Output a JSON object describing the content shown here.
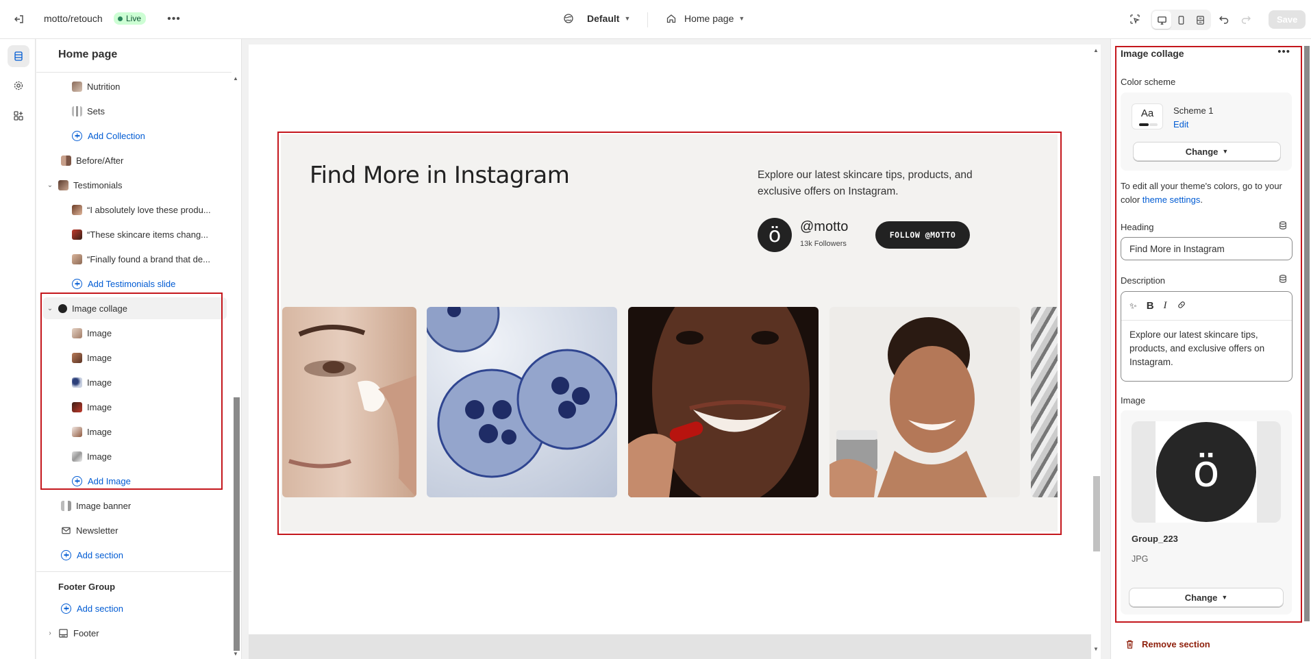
{
  "topbar": {
    "store_name": "motto/retouch",
    "status": "Live",
    "theme_dropdown": "Default",
    "page_dropdown": "Home page",
    "save_label": "Save"
  },
  "sidebar": {
    "title": "Home page",
    "items": [
      {
        "label": "Nutrition",
        "level": 2,
        "type": "block"
      },
      {
        "label": "Sets",
        "level": 2,
        "type": "block"
      },
      {
        "label": "Add Collection",
        "level": 2,
        "type": "add"
      },
      {
        "label": "Before/After",
        "level": 1,
        "type": "section"
      },
      {
        "label": "Testimonials",
        "level": 1,
        "type": "section",
        "expanded": true
      },
      {
        "label": "“I absolutely love these produ...",
        "level": 2,
        "type": "block"
      },
      {
        "label": "“These skincare items chang...",
        "level": 2,
        "type": "block"
      },
      {
        "label": "“Finally found a brand that de...",
        "level": 2,
        "type": "block"
      },
      {
        "label": "Add Testimonials slide",
        "level": 2,
        "type": "add"
      },
      {
        "label": "Image collage",
        "level": 1,
        "type": "section",
        "expanded": true,
        "selected": true
      },
      {
        "label": "Image",
        "level": 2,
        "type": "block"
      },
      {
        "label": "Image",
        "level": 2,
        "type": "block"
      },
      {
        "label": "Image",
        "level": 2,
        "type": "block"
      },
      {
        "label": "Image",
        "level": 2,
        "type": "block"
      },
      {
        "label": "Image",
        "level": 2,
        "type": "block"
      },
      {
        "label": "Image",
        "level": 2,
        "type": "block"
      },
      {
        "label": "Add Image",
        "level": 2,
        "type": "add"
      },
      {
        "label": "Image banner",
        "level": 1,
        "type": "section"
      },
      {
        "label": "Newsletter",
        "level": 1,
        "type": "section"
      },
      {
        "label": "Add section",
        "level": 1,
        "type": "add"
      }
    ],
    "footer_group": {
      "title": "Footer Group",
      "add_label": "Add section",
      "footer_label": "Footer"
    }
  },
  "preview": {
    "heading": "Find More in Instagram",
    "description": "Explore our latest skincare tips, products, and exclusive offers on Instagram.",
    "avatar_letter": "ö",
    "handle": "@motto",
    "followers": "13k Followers",
    "follow_button": "FOLLOW @MOTTO"
  },
  "panel": {
    "title": "Image collage",
    "color_scheme_label": "Color scheme",
    "scheme_swatch": "Aa",
    "scheme_name": "Scheme 1",
    "scheme_edit": "Edit",
    "change_label": "Change",
    "help_text_pre": "To edit all your theme's colors, go to your color ",
    "help_link": "theme settings",
    "help_text_post": ".",
    "heading_label": "Heading",
    "heading_value": "Find More in Instagram",
    "description_label": "Description",
    "description_value": "Explore our latest skincare tips, products, and exclusive offers on Instagram.",
    "image_label": "Image",
    "image_letter": "ö",
    "image_name": "Group_223",
    "image_type": "JPG",
    "image_change_label": "Change",
    "remove_label": "Remove section"
  },
  "colors": {
    "accent_link": "#005bd3",
    "highlight_red": "#c4161c",
    "live_green": "#29845a",
    "danger": "#8e1f0b"
  }
}
